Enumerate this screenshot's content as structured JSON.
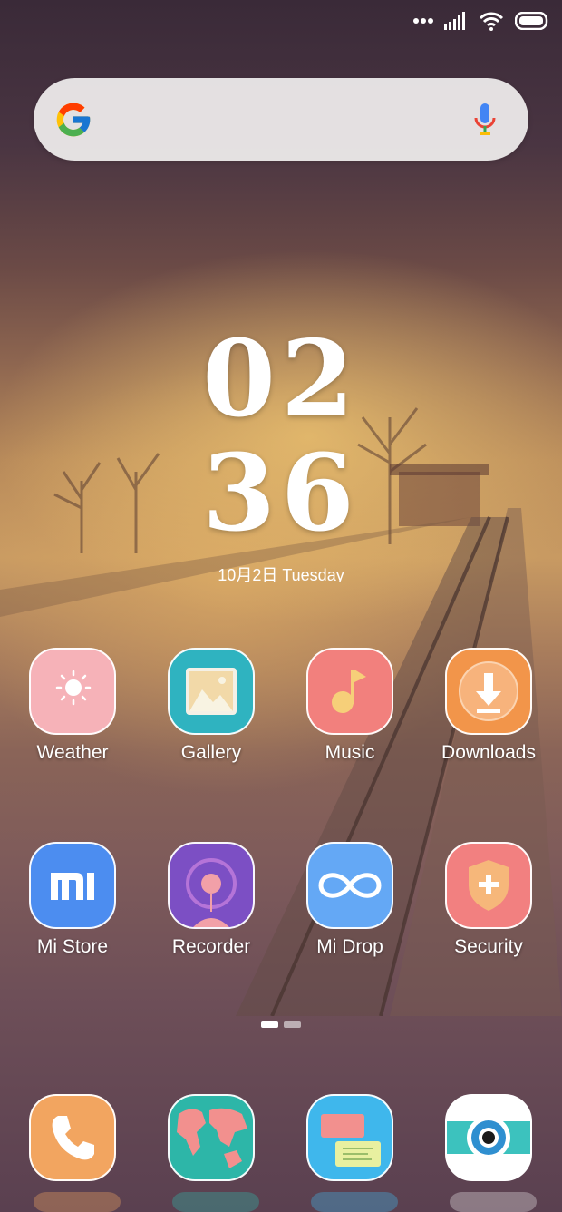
{
  "status_bar": {
    "icons": [
      "dots-icon",
      "signal-icon",
      "wifi-icon",
      "battery-icon"
    ]
  },
  "search": {
    "icons": [
      "google-g-icon",
      "mic-icon"
    ]
  },
  "clock": {
    "hours": "02",
    "minutes": "36",
    "date": "10月2日 Tuesday"
  },
  "apps_row1": [
    {
      "label": "Weather"
    },
    {
      "label": "Gallery"
    },
    {
      "label": "Music"
    },
    {
      "label": "Downloads"
    }
  ],
  "apps_row2": [
    {
      "label": "Mi Store"
    },
    {
      "label": "Recorder"
    },
    {
      "label": "Mi Drop"
    },
    {
      "label": "Security"
    }
  ],
  "dock": [
    {
      "icon": "phone-icon"
    },
    {
      "icon": "globe-map-icon"
    },
    {
      "icon": "messages-icon"
    },
    {
      "icon": "camera-icon"
    }
  ],
  "colors": {
    "weather": "#F6B2B8",
    "gallery": "#2FB3C0",
    "music": "#F2807D",
    "downloads": "#F2954A",
    "mi_store": "#4C8DF0",
    "recorder": "#7C4FC4",
    "mi_drop": "#64A8F5",
    "security": "#F28080",
    "dock_phone": "#F2A560",
    "dock_globe": "#2DB6A8",
    "dock_messages": "#3FB7EC",
    "dock_camera": "#FFFFFF"
  }
}
